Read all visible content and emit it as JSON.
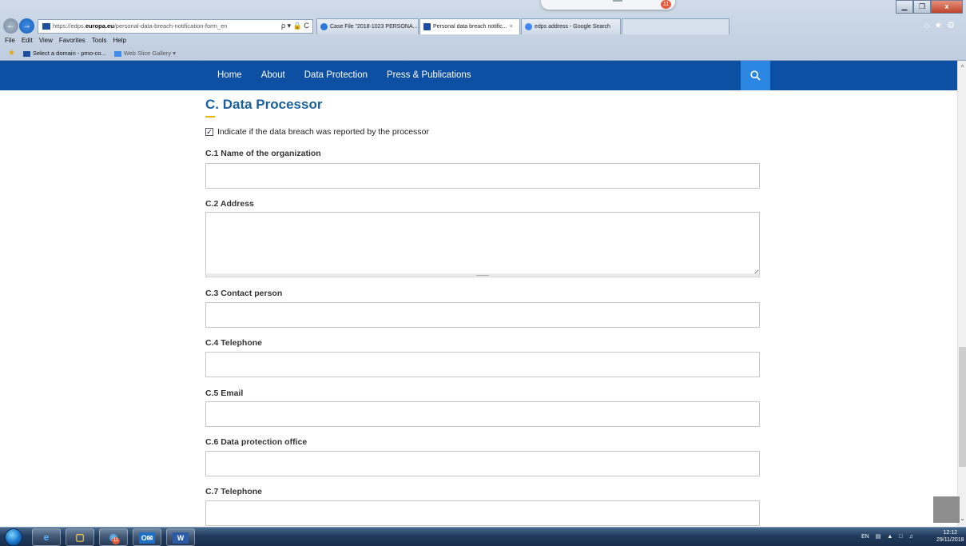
{
  "browser": {
    "url_prefix": "https://edps.",
    "url_domain": "europa.eu",
    "url_path": "/personal-data-breach-notification-form_en",
    "address_tools": "ρ ▾ 🔒 C",
    "tabs": [
      {
        "label": "Case File \"2018-1023 PERSONA...",
        "icon_color": "#2b77d8",
        "active": false
      },
      {
        "label": "Personal data breach notific...",
        "icon_color": "#1d4f9e",
        "active": true,
        "close": "×"
      },
      {
        "label": "edps address - Google Search",
        "icon_color": "#4285f4",
        "active": false
      }
    ],
    "title_notification_count": "11",
    "window_buttons": {
      "minimize": "▁",
      "restore": "❐",
      "close": "x"
    },
    "right_icons": "⌂★⚙",
    "menu": [
      "File",
      "Edit",
      "View",
      "Favorites",
      "Tools",
      "Help"
    ],
    "favorites": {
      "item1": "Select a domain - pmo-co...",
      "item2": "Web Slice Gallery ▾"
    }
  },
  "site_nav": {
    "links": [
      "Home",
      "About",
      "Data Protection",
      "Press & Publications"
    ],
    "search_icon": "search-icon"
  },
  "form": {
    "section_title": "C. Data Processor",
    "checkbox_label": "Indicate if the data breach was reported by the processor",
    "checkbox_checked": true,
    "fields": [
      {
        "label": "C.1 Name of the organization",
        "value": ""
      },
      {
        "label": "C.2 Address",
        "value": ""
      },
      {
        "label": "C.3 Contact person",
        "value": ""
      },
      {
        "label": "C.4 Telephone",
        "value": ""
      },
      {
        "label": "C.5 Email",
        "value": ""
      },
      {
        "label": "C.6 Data protection office",
        "value": ""
      },
      {
        "label": "C.7 Telephone",
        "value": ""
      }
    ]
  },
  "taskbar": {
    "outlook_badge": "11",
    "tray_lang": "EN",
    "clock_time": "12:12",
    "clock_date": "29/11/2018"
  }
}
